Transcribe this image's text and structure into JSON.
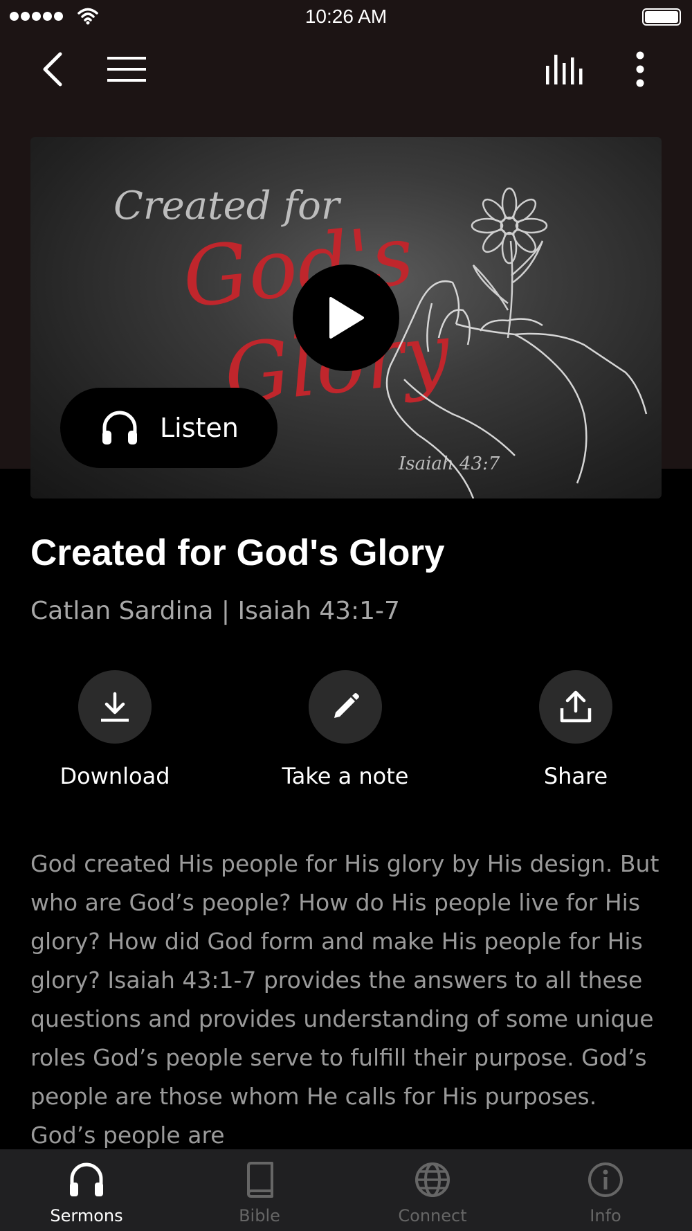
{
  "status_bar": {
    "time": "10:26 AM"
  },
  "nav": {
    "back_icon": "chevron-left-icon",
    "menu_icon": "hamburger-icon",
    "audio_icon": "equalizer-icon",
    "more_icon": "more-vertical-icon"
  },
  "hero": {
    "artwork_text": {
      "line1": "Created for",
      "line2": "God's",
      "line3": "Glory",
      "reference": "Isaiah 43:7"
    },
    "play_icon": "play-icon",
    "listen_label": "Listen",
    "listen_icon": "headphones-icon"
  },
  "sermon": {
    "title": "Created for God's Glory",
    "subtitle": "Catlan Sardina | Isaiah 43:1-7"
  },
  "actions": [
    {
      "label": "Download",
      "icon": "download-icon"
    },
    {
      "label": "Take a note",
      "icon": "pencil-icon"
    },
    {
      "label": "Share",
      "icon": "share-icon"
    }
  ],
  "description": "God created His people for His glory by His design. But who are God’s people? How do His people live for His glory? How did God form and make His people for His glory? Isaiah 43:1-7 provides the answers to all these questions and provides understanding of some unique roles God’s people serve to fulfill their purpose. God’s people are those whom He calls for His purposes. God’s people are",
  "tab_bar": {
    "tabs": [
      {
        "label": "Sermons",
        "icon": "headphones-icon",
        "active": true
      },
      {
        "label": "Bible",
        "icon": "book-icon",
        "active": false
      },
      {
        "label": "Connect",
        "icon": "globe-icon",
        "active": false
      },
      {
        "label": "Info",
        "icon": "info-icon",
        "active": false
      }
    ]
  },
  "colors": {
    "header_bg": "#1c1414",
    "page_bg": "#000000",
    "artwork_red": "#c0262c",
    "tab_bar_bg": "#202022"
  }
}
